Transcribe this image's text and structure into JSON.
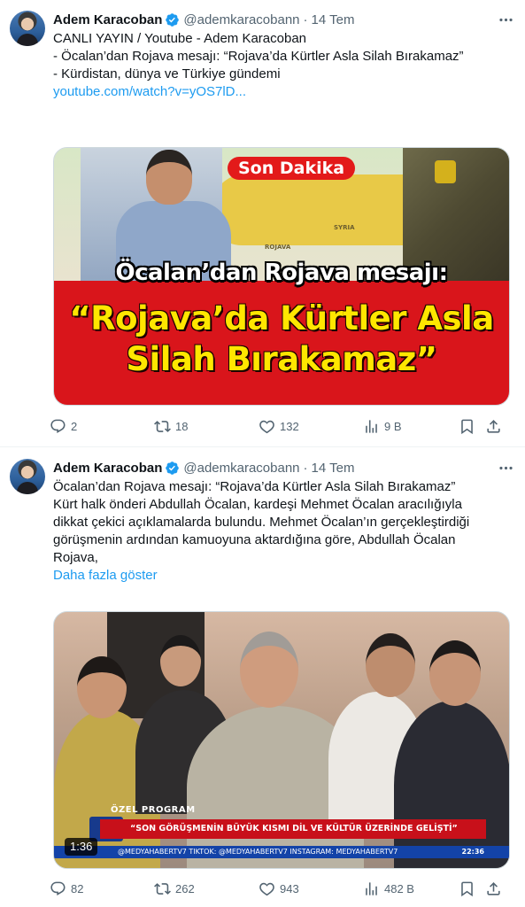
{
  "tweets": [
    {
      "author": {
        "name": "Adem Karacoban",
        "handle": "@ademkaracobann",
        "time": "14 Tem"
      },
      "text_lines": [
        "CANLI YAYIN / Youtube - Adem Karacoban",
        "",
        "- Öcalan’dan Rojava mesajı: “Rojava’da Kürtler Asla Silah Bırakamaz”",
        "- Kürdistan, dünya ve Türkiye gündemi",
        ""
      ],
      "link": "youtube.com/watch?v=yOS7lD...",
      "image": {
        "badge": "Son Dakika",
        "map_labels": [
          "SYRIA",
          "ROJAVA"
        ],
        "subtitle": "Öcalan’dan Rojava mesajı:",
        "quote_line1": "“Rojava’da Kürtler Asla",
        "quote_line2": "Silah Bırakamaz”"
      },
      "stats": {
        "replies": "2",
        "retweets": "18",
        "likes": "132",
        "views": "9 B"
      }
    },
    {
      "author": {
        "name": "Adem Karacoban",
        "handle": "@ademkaracobann",
        "time": "14 Tem"
      },
      "text_lines": [
        "Öcalan’dan Rojava mesajı: “Rojava’da Kürtler Asla Silah Bırakamaz”",
        "",
        "Kürt halk önderi Abdullah Öcalan, kardeşi Mehmet Öcalan aracılığıyla",
        "dikkat çekici açıklamalarda bulundu. Mehmet Öcalan’ın gerçekleştirdiği",
        "görüşmenin ardından kamuoyuna aktardığına göre, Abdullah Öcalan",
        "Rojava,"
      ],
      "show_more": "Daha fazla göster",
      "video": {
        "program_label": "ÖZEL PROGRAM",
        "ticker": "“SON GÖRÜŞMENİN BÜYÜK KISMI DİL VE KÜLTÜR ÜZERİNDE GELİŞTİ”",
        "bottom_bar": "@MEDYAHABERTV7   TIKTOK: @MEDYAHABERTV7   INSTAGRAM: MEDYAHABERTV7",
        "clock": "22:36",
        "duration": "1:36"
      },
      "stats": {
        "replies": "82",
        "retweets": "262",
        "likes": "943",
        "views": "482 B"
      }
    }
  ],
  "colors": {
    "link": "#1d9bf0",
    "secondary_text": "#536471",
    "verified": "#1d9bf0",
    "breaking_red": "#d9151b",
    "quote_yellow": "#ffe600"
  },
  "icons": [
    "more-icon",
    "verified-icon",
    "reply-icon",
    "retweet-icon",
    "like-icon",
    "views-icon",
    "bookmark-icon",
    "share-icon"
  ]
}
